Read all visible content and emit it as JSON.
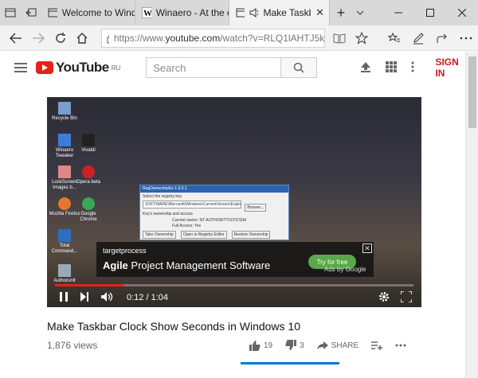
{
  "browser": {
    "tabs": [
      {
        "title": "Welcome to Window",
        "icon": "window-icon"
      },
      {
        "title": "Winaero - At the edg",
        "icon": "winaero-w-icon"
      },
      {
        "title": "Make Taskbar",
        "icon": "tab-preview-icon",
        "audio": true,
        "active": true
      }
    ],
    "address": {
      "url_prefix": "https://www.",
      "url_host": "youtube.com",
      "url_rest": "/watch?v=RLQ1lAHTJ5k"
    }
  },
  "youtube": {
    "logo_text": "YouTube",
    "logo_region": "RU",
    "search_placeholder": "Search",
    "signin_label": "SIGN IN"
  },
  "video": {
    "title": "Make Taskbar Clock Show Seconds in Windows 10",
    "views": "1,876 views",
    "time": "0:12 / 1:04",
    "progress": 0.19,
    "likes": "19",
    "dislikes": "3",
    "share_label": "SHARE"
  },
  "desktop_icons": [
    {
      "label": "Recycle Bin"
    },
    {
      "label": "Winaero Tweaker"
    },
    {
      "label": "Vivaldi"
    },
    {
      "label": "LockScreen Images b..."
    },
    {
      "label": "Opera beta"
    },
    {
      "label": "Mozilla Firefox"
    },
    {
      "label": "Google Chrome"
    },
    {
      "label": "Total Command..."
    },
    {
      "label": "Authorunlt"
    }
  ],
  "regwin": {
    "title": "RegOwnershipEx 1.0.0.1",
    "prompt": "Select the registry key",
    "key": "SOFTWARE\\Microsoft\\Windows\\CurrentVersion\\Explorer\\Advanced",
    "browse": "Browse...",
    "owner_section": "Key's ownership and access",
    "owner_label": "Current owner:",
    "owner_value": "NT AUTHORITY\\SYSTEM",
    "access_label": "Full Access:",
    "access_value": "Yes",
    "take_btn": "Take Ownership",
    "open_btn": "Open in Registry Editor",
    "restore_btn": "Restore Ownership"
  },
  "ad": {
    "brand": "targetprocess",
    "title_bold": "Agile",
    "title_rest": " Project Management Software",
    "cta": "Try for free",
    "by": "Ads by Google"
  }
}
